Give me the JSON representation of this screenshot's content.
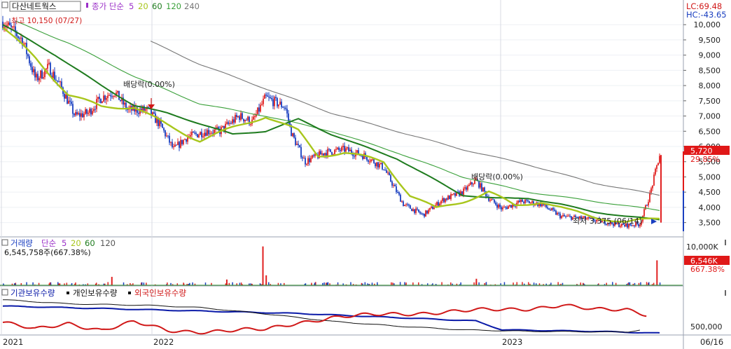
{
  "header": {
    "stock_name": "다산네트웍스",
    "ma_label": "종가 단순",
    "ma_periods": [
      "5",
      "20",
      "60",
      "120",
      "240"
    ],
    "lc": "LC:69.48",
    "hc": "HC:-43.65"
  },
  "volume_header": {
    "label": "거래량",
    "ma_label": "단순",
    "ma_periods": [
      "5",
      "20",
      "60",
      "120"
    ],
    "value_text": "6,545,758주(667.38%)"
  },
  "holdings_header": {
    "legend": [
      "기관보유수량",
      "개인보유수량",
      "외국인보유수량"
    ]
  },
  "annotations": {
    "high": "최고 10,150 (07/27)",
    "low": "최저 3,375 (06/14)",
    "dividend_1": "배당락(0.00%)",
    "dividend_2": "배당락(0.00%)"
  },
  "badges": {
    "price": "5,720",
    "price_change": "29.85%",
    "volume": "6,546K",
    "volume_change": "667.38%"
  },
  "colors": {
    "ma5": "#9b30c8",
    "ma20": "#a8c61c",
    "ma60": "#1e7b1e",
    "ma120": "#3aa03a",
    "ma240": "#777777",
    "up": "#e02020",
    "down": "#1a3fc0",
    "institution": "#0a1aa8",
    "individual": "#111111",
    "foreign": "#d01818"
  },
  "chart_data": [
    {
      "type": "candlestick",
      "yaxis_ticks": [
        "10,000",
        "9,500",
        "9,000",
        "8,500",
        "8,000",
        "7,500",
        "7,000",
        "6,500",
        "6,000",
        "5,500",
        "5,000",
        "4,500",
        "4,000",
        "3,500"
      ],
      "ylim": [
        3100,
        10350
      ],
      "xaxis_ticks": [
        "2021",
        "2022",
        "2023",
        "06/16"
      ],
      "price_keypoints": [
        {
          "x": 0.0,
          "y": 10100
        },
        {
          "x": 0.03,
          "y": 9500
        },
        {
          "x": 0.05,
          "y": 8200
        },
        {
          "x": 0.07,
          "y": 8600
        },
        {
          "x": 0.09,
          "y": 7900
        },
        {
          "x": 0.11,
          "y": 7000
        },
        {
          "x": 0.13,
          "y": 7100
        },
        {
          "x": 0.15,
          "y": 7600
        },
        {
          "x": 0.17,
          "y": 7800
        },
        {
          "x": 0.19,
          "y": 7200
        },
        {
          "x": 0.22,
          "y": 7200
        },
        {
          "x": 0.24,
          "y": 6700
        },
        {
          "x": 0.26,
          "y": 5900
        },
        {
          "x": 0.28,
          "y": 6300
        },
        {
          "x": 0.31,
          "y": 6500
        },
        {
          "x": 0.33,
          "y": 6500
        },
        {
          "x": 0.36,
          "y": 7000
        },
        {
          "x": 0.38,
          "y": 6800
        },
        {
          "x": 0.4,
          "y": 7600
        },
        {
          "x": 0.43,
          "y": 7300
        },
        {
          "x": 0.44,
          "y": 6400
        },
        {
          "x": 0.46,
          "y": 5500
        },
        {
          "x": 0.49,
          "y": 5800
        },
        {
          "x": 0.52,
          "y": 5900
        },
        {
          "x": 0.55,
          "y": 5700
        },
        {
          "x": 0.58,
          "y": 5300
        },
        {
          "x": 0.61,
          "y": 4100
        },
        {
          "x": 0.64,
          "y": 3750
        },
        {
          "x": 0.67,
          "y": 4250
        },
        {
          "x": 0.7,
          "y": 4500
        },
        {
          "x": 0.72,
          "y": 4900
        },
        {
          "x": 0.74,
          "y": 4300
        },
        {
          "x": 0.76,
          "y": 3950
        },
        {
          "x": 0.79,
          "y": 4200
        },
        {
          "x": 0.82,
          "y": 4100
        },
        {
          "x": 0.85,
          "y": 3700
        },
        {
          "x": 0.88,
          "y": 3650
        },
        {
          "x": 0.91,
          "y": 3550
        },
        {
          "x": 0.945,
          "y": 3400
        },
        {
          "x": 0.97,
          "y": 3450
        },
        {
          "x": 0.985,
          "y": 4400
        },
        {
          "x": 1.0,
          "y": 5720
        }
      ],
      "ma_keypoints": {
        "ma20": [
          {
            "x": 0.0,
            "y": 9900
          },
          {
            "x": 0.05,
            "y": 8900
          },
          {
            "x": 0.1,
            "y": 7700
          },
          {
            "x": 0.15,
            "y": 7300
          },
          {
            "x": 0.2,
            "y": 7300
          },
          {
            "x": 0.25,
            "y": 6700
          },
          {
            "x": 0.3,
            "y": 6200
          },
          {
            "x": 0.35,
            "y": 6600
          },
          {
            "x": 0.4,
            "y": 7000
          },
          {
            "x": 0.45,
            "y": 6500
          },
          {
            "x": 0.48,
            "y": 5700
          },
          {
            "x": 0.52,
            "y": 5800
          },
          {
            "x": 0.58,
            "y": 5500
          },
          {
            "x": 0.62,
            "y": 4400
          },
          {
            "x": 0.66,
            "y": 3950
          },
          {
            "x": 0.7,
            "y": 4200
          },
          {
            "x": 0.74,
            "y": 4500
          },
          {
            "x": 0.78,
            "y": 4050
          },
          {
            "x": 0.82,
            "y": 4200
          },
          {
            "x": 0.86,
            "y": 3900
          },
          {
            "x": 0.9,
            "y": 3700
          },
          {
            "x": 0.95,
            "y": 3500
          },
          {
            "x": 1.0,
            "y": 3650
          }
        ],
        "ma60": [
          {
            "x": 0.0,
            "y": 10000
          },
          {
            "x": 0.08,
            "y": 9000
          },
          {
            "x": 0.15,
            "y": 8000
          },
          {
            "x": 0.2,
            "y": 7350
          },
          {
            "x": 0.25,
            "y": 7100
          },
          {
            "x": 0.3,
            "y": 6750
          },
          {
            "x": 0.35,
            "y": 6400
          },
          {
            "x": 0.4,
            "y": 6500
          },
          {
            "x": 0.45,
            "y": 6900
          },
          {
            "x": 0.5,
            "y": 6400
          },
          {
            "x": 0.55,
            "y": 6000
          },
          {
            "x": 0.6,
            "y": 5600
          },
          {
            "x": 0.65,
            "y": 5000
          },
          {
            "x": 0.7,
            "y": 4400
          },
          {
            "x": 0.75,
            "y": 4300
          },
          {
            "x": 0.8,
            "y": 4300
          },
          {
            "x": 0.85,
            "y": 4100
          },
          {
            "x": 0.9,
            "y": 3850
          },
          {
            "x": 0.95,
            "y": 3700
          },
          {
            "x": 1.0,
            "y": 3600
          }
        ],
        "ma120": [
          {
            "x": 0.02,
            "y": 10100
          },
          {
            "x": 0.1,
            "y": 9400
          },
          {
            "x": 0.2,
            "y": 8300
          },
          {
            "x": 0.3,
            "y": 7400
          },
          {
            "x": 0.4,
            "y": 7000
          },
          {
            "x": 0.5,
            "y": 6500
          },
          {
            "x": 0.6,
            "y": 5800
          },
          {
            "x": 0.7,
            "y": 5000
          },
          {
            "x": 0.8,
            "y": 4500
          },
          {
            "x": 0.9,
            "y": 4200
          },
          {
            "x": 1.0,
            "y": 3900
          }
        ],
        "ma240": [
          {
            "x": 0.225,
            "y": 9450
          },
          {
            "x": 0.3,
            "y": 8700
          },
          {
            "x": 0.4,
            "y": 7900
          },
          {
            "x": 0.5,
            "y": 7100
          },
          {
            "x": 0.6,
            "y": 6500
          },
          {
            "x": 0.7,
            "y": 5900
          },
          {
            "x": 0.8,
            "y": 5400
          },
          {
            "x": 0.9,
            "y": 4800
          },
          {
            "x": 1.0,
            "y": 4400
          }
        ]
      }
    },
    {
      "type": "bar",
      "name": "volume",
      "yaxis_ticks": [
        "10,000K"
      ],
      "spikes": [
        {
          "x": 0.395,
          "v": 10200
        },
        {
          "x": 0.4,
          "v": 2600
        },
        {
          "x": 0.165,
          "v": 2200
        },
        {
          "x": 0.34,
          "v": 1500
        },
        {
          "x": 0.72,
          "v": 1700
        },
        {
          "x": 0.995,
          "v": 6546
        }
      ]
    },
    {
      "type": "line",
      "name": "holdings",
      "yaxis_ticks": [
        "500,000"
      ],
      "series": [
        {
          "name": "기관보유수량",
          "keypoints": [
            {
              "x": 0.0,
              "y": 0.76
            },
            {
              "x": 0.45,
              "y": 0.56
            },
            {
              "x": 0.72,
              "y": 0.36
            },
            {
              "x": 0.76,
              "y": 0.12
            },
            {
              "x": 0.9,
              "y": 0.08
            },
            {
              "x": 1.0,
              "y": 0.03
            }
          ]
        },
        {
          "name": "개인보유수량",
          "keypoints": [
            {
              "x": 0.0,
              "y": 0.93
            },
            {
              "x": 0.1,
              "y": 0.82
            },
            {
              "x": 0.22,
              "y": 0.78
            },
            {
              "x": 0.3,
              "y": 0.72
            },
            {
              "x": 0.4,
              "y": 0.55
            },
            {
              "x": 0.5,
              "y": 0.35
            },
            {
              "x": 0.6,
              "y": 0.22
            },
            {
              "x": 0.7,
              "y": 0.12
            },
            {
              "x": 0.8,
              "y": 0.08
            },
            {
              "x": 0.95,
              "y": 0.06
            },
            {
              "x": 0.97,
              "y": 0.12
            }
          ]
        },
        {
          "name": "외국인보유수량",
          "keypoints": [
            {
              "x": 0.0,
              "y": 0.32
            },
            {
              "x": 0.05,
              "y": 0.12
            },
            {
              "x": 0.1,
              "y": 0.3
            },
            {
              "x": 0.15,
              "y": 0.12
            },
            {
              "x": 0.2,
              "y": 0.32
            },
            {
              "x": 0.25,
              "y": 0.1
            },
            {
              "x": 0.3,
              "y": 0.08
            },
            {
              "x": 0.4,
              "y": 0.12
            },
            {
              "x": 0.45,
              "y": 0.32
            },
            {
              "x": 0.5,
              "y": 0.45
            },
            {
              "x": 0.55,
              "y": 0.5
            },
            {
              "x": 0.6,
              "y": 0.55
            },
            {
              "x": 0.7,
              "y": 0.62
            },
            {
              "x": 0.8,
              "y": 0.7
            },
            {
              "x": 0.85,
              "y": 0.78
            },
            {
              "x": 0.9,
              "y": 0.65
            },
            {
              "x": 0.95,
              "y": 0.68
            },
            {
              "x": 0.98,
              "y": 0.55
            }
          ]
        }
      ]
    }
  ]
}
